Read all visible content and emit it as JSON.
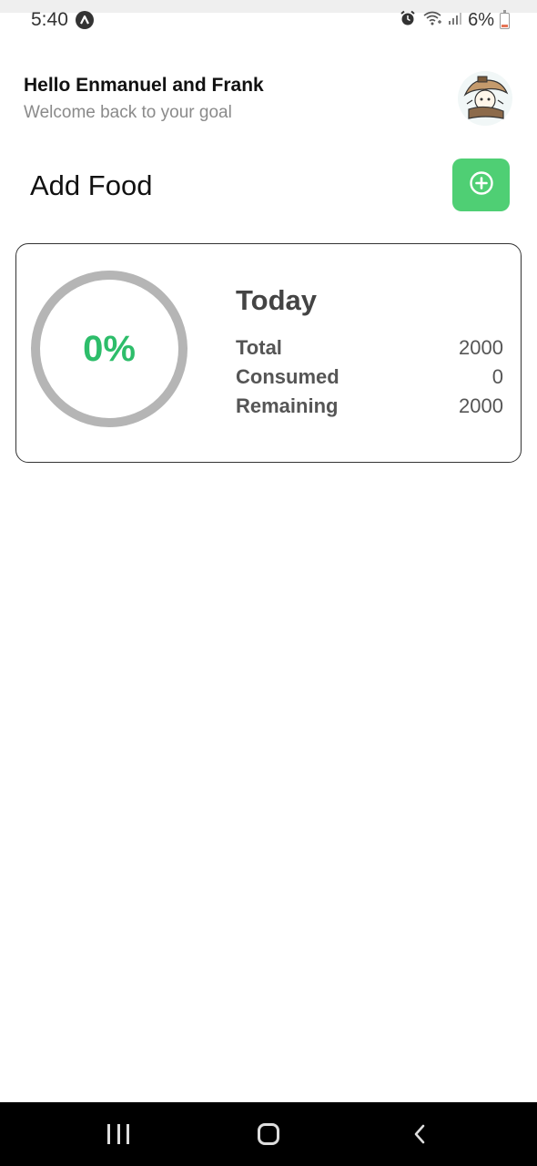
{
  "status_bar": {
    "time": "5:40",
    "battery": "6%",
    "icons": [
      "app-notification-icon",
      "alarm-icon",
      "wifi-icon",
      "signal-icon",
      "battery-icon"
    ]
  },
  "header": {
    "title": "Hello Enmanuel and Frank",
    "subtitle": "Welcome back to your goal"
  },
  "add_food": {
    "label": "Add Food",
    "button_icon": "plus-circle-icon",
    "button_color": "#4fcf74"
  },
  "summary": {
    "progress_percent": 0,
    "progress_label": "0%",
    "progress_color": "#2dbd6a",
    "ring_color": "#b5b5b5",
    "title": "Today",
    "rows": [
      {
        "label": "Total",
        "value": "2000"
      },
      {
        "label": "Consumed",
        "value": "0"
      },
      {
        "label": "Remaining",
        "value": "2000"
      }
    ]
  },
  "nav_bar": {
    "icons": [
      "recents-icon",
      "home-icon",
      "back-icon"
    ]
  }
}
